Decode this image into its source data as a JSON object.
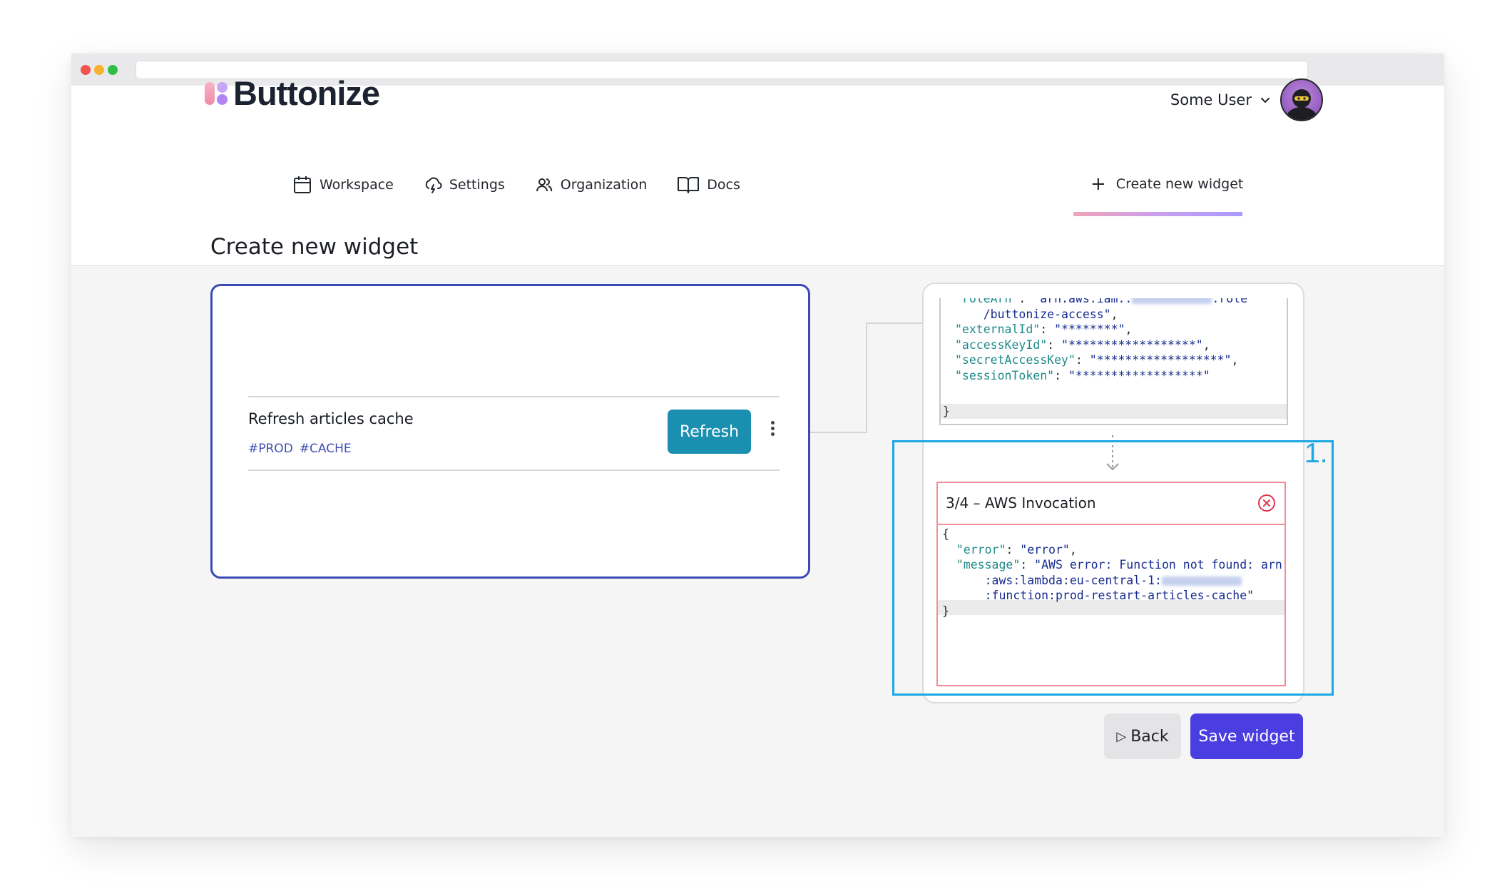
{
  "app": {
    "logo_text": "Buttonize"
  },
  "user": {
    "name": "Some User"
  },
  "nav": {
    "items": [
      {
        "label": "Workspace"
      },
      {
        "label": "Settings"
      },
      {
        "label": "Organization"
      },
      {
        "label": "Docs"
      }
    ],
    "create_label": "Create new widget"
  },
  "page": {
    "title": "Create new widget"
  },
  "widget": {
    "name": "Refresh articles cache",
    "tags": [
      "#PROD",
      "#CACHE"
    ],
    "button_label": "Refresh"
  },
  "flow": {
    "top_code": {
      "role_key": "\"roleArn\"",
      "role_val_start": "\"arn:aws:iam::",
      "role_val_end": ":role",
      "role_val_cont": "/buttonize-access\"",
      "external_key": "\"externalId\"",
      "external_val": "\"********\"",
      "access_key": "\"accessKeyId\"",
      "access_val": "\"******************\"",
      "secret_key": "\"secretAccessKey\"",
      "secret_val": "\"******************\"",
      "session_key": "\"sessionToken\"",
      "session_val": "\"******************\""
    },
    "step": {
      "title": "3/4 – AWS Invocation",
      "error_key": "\"error\"",
      "error_val": "\"error\"",
      "message_key": "\"message\"",
      "message_line1": "\"AWS error: Function not found: arn",
      "message_line2": ":aws:lambda:eu-central-1:",
      "message_line3": ":function:prod-restart-articles-cache\""
    }
  },
  "annotation": {
    "label": "1."
  },
  "actions": {
    "back_label": "Back",
    "save_label": "Save widget"
  },
  "colors": {
    "accent": "#4b3ee0",
    "refresh_button": "#1b8fb0",
    "highlight": "#1ba7e3",
    "error": "#f08f98"
  }
}
